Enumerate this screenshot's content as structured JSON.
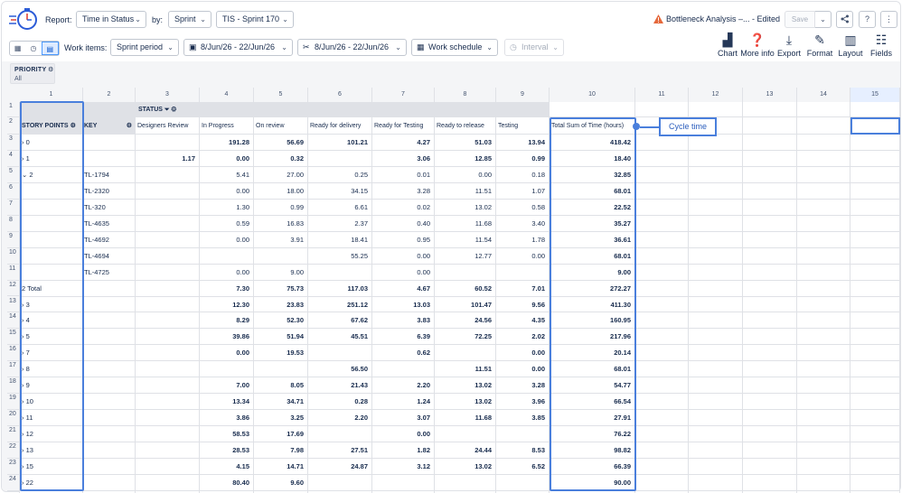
{
  "toolbar": {
    "report_label": "Report:",
    "report_value": "Time in Status",
    "by_label": "by:",
    "by_value": "Sprint",
    "sprint_value": "TIS - Sprint 170",
    "bottleneck_title": "Bottleneck Analysis –... - Edited",
    "save_label": "Save",
    "work_items_label": "Work items:",
    "work_items_value": "Sprint period",
    "date_range_1": "8/Jun/26 - 22/Jun/26",
    "date_range_2": "8/Jun/26 - 22/Jun/26",
    "work_schedule": "Work schedule",
    "interval": "Interval",
    "actions": {
      "chart": "Chart",
      "more_info": "More info",
      "export": "Export",
      "format": "Format",
      "layout": "Layout",
      "fields": "Fields"
    }
  },
  "priority": {
    "title": "PRIORITY",
    "value": "All"
  },
  "status_label": "STATUS",
  "col_numbers": [
    "1",
    "2",
    "3",
    "4",
    "5",
    "6",
    "7",
    "8",
    "9",
    "10",
    "11",
    "12",
    "13",
    "14",
    "15"
  ],
  "row_numbers": [
    "1",
    "2",
    "3",
    "4",
    "5",
    "6",
    "7",
    "8",
    "9",
    "10",
    "11",
    "12",
    "13",
    "14",
    "15",
    "16",
    "17",
    "18",
    "19",
    "20",
    "21",
    "22",
    "23",
    "24"
  ],
  "headers": {
    "story_points": "STORY POINTS",
    "key": "KEY",
    "statuses": [
      "Designers Review",
      "In Progress",
      "On review",
      "Ready for delivery",
      "Ready for Testing",
      "Ready to release",
      "Testing",
      "Total Sum of Time (hours)"
    ]
  },
  "rows": [
    {
      "sp": "0",
      "expand": ">",
      "key": "",
      "vals": [
        "",
        "191.28",
        "56.69",
        "101.21",
        "4.27",
        "51.03",
        "13.94",
        "418.42"
      ],
      "bold": true
    },
    {
      "sp": "1",
      "expand": ">",
      "key": "",
      "vals": [
        "1.17",
        "0.00",
        "0.32",
        "",
        "3.06",
        "12.85",
        "0.99",
        "18.40"
      ],
      "bold": true
    },
    {
      "sp": "2",
      "expand": "v",
      "key": "TL-1794",
      "vals": [
        "",
        "5.41",
        "27.00",
        "0.25",
        "0.01",
        "0.00",
        "0.18",
        "32.85"
      ],
      "bold": false
    },
    {
      "sp": "",
      "expand": "",
      "key": "TL-2320",
      "vals": [
        "",
        "0.00",
        "18.00",
        "34.15",
        "3.28",
        "11.51",
        "1.07",
        "68.01"
      ],
      "bold": false
    },
    {
      "sp": "",
      "expand": "",
      "key": "TL-320",
      "vals": [
        "",
        "1.30",
        "0.99",
        "6.61",
        "0.02",
        "13.02",
        "0.58",
        "22.52"
      ],
      "bold": false
    },
    {
      "sp": "",
      "expand": "",
      "key": "TL-4635",
      "vals": [
        "",
        "0.59",
        "16.83",
        "2.37",
        "0.40",
        "11.68",
        "3.40",
        "35.27"
      ],
      "bold": false
    },
    {
      "sp": "",
      "expand": "",
      "key": "TL-4692",
      "vals": [
        "",
        "0.00",
        "3.91",
        "18.41",
        "0.95",
        "11.54",
        "1.78",
        "36.61"
      ],
      "bold": false
    },
    {
      "sp": "",
      "expand": "",
      "key": "TL-4694",
      "vals": [
        "",
        "",
        "",
        "55.25",
        "0.00",
        "12.77",
        "0.00",
        "68.01"
      ],
      "bold": false
    },
    {
      "sp": "",
      "expand": "",
      "key": "TL-4725",
      "vals": [
        "",
        "0.00",
        "9.00",
        "",
        "0.00",
        "",
        "",
        "9.00"
      ],
      "bold": false
    },
    {
      "sp": "2 Total",
      "expand": "",
      "key": "",
      "vals": [
        "",
        "7.30",
        "75.73",
        "117.03",
        "4.67",
        "60.52",
        "7.01",
        "272.27"
      ],
      "bold": true,
      "total": true
    },
    {
      "sp": "3",
      "expand": ">",
      "key": "",
      "vals": [
        "",
        "12.30",
        "23.83",
        "251.12",
        "13.03",
        "101.47",
        "9.56",
        "411.30"
      ],
      "bold": true
    },
    {
      "sp": "4",
      "expand": ">",
      "key": "",
      "vals": [
        "",
        "8.29",
        "52.30",
        "67.62",
        "3.83",
        "24.56",
        "4.35",
        "160.95"
      ],
      "bold": true
    },
    {
      "sp": "5",
      "expand": ">",
      "key": "",
      "vals": [
        "",
        "39.86",
        "51.94",
        "45.51",
        "6.39",
        "72.25",
        "2.02",
        "217.96"
      ],
      "bold": true
    },
    {
      "sp": "7",
      "expand": ">",
      "key": "",
      "vals": [
        "",
        "0.00",
        "19.53",
        "",
        "0.62",
        "",
        "0.00",
        "20.14"
      ],
      "bold": true
    },
    {
      "sp": "8",
      "expand": ">",
      "key": "",
      "vals": [
        "",
        "",
        "",
        "56.50",
        "",
        "11.51",
        "0.00",
        "68.01"
      ],
      "bold": true
    },
    {
      "sp": "9",
      "expand": ">",
      "key": "",
      "vals": [
        "",
        "7.00",
        "8.05",
        "21.43",
        "2.20",
        "13.02",
        "3.28",
        "54.77"
      ],
      "bold": true
    },
    {
      "sp": "10",
      "expand": ">",
      "key": "",
      "vals": [
        "",
        "13.34",
        "34.71",
        "0.28",
        "1.24",
        "13.02",
        "3.96",
        "66.54"
      ],
      "bold": true
    },
    {
      "sp": "11",
      "expand": ">",
      "key": "",
      "vals": [
        "",
        "3.86",
        "3.25",
        "2.20",
        "3.07",
        "11.68",
        "3.85",
        "27.91"
      ],
      "bold": true
    },
    {
      "sp": "12",
      "expand": ">",
      "key": "",
      "vals": [
        "",
        "58.53",
        "17.69",
        "",
        "0.00",
        "",
        "",
        "76.22"
      ],
      "bold": true
    },
    {
      "sp": "13",
      "expand": ">",
      "key": "",
      "vals": [
        "",
        "28.53",
        "7.98",
        "27.51",
        "1.82",
        "24.44",
        "8.53",
        "98.82"
      ],
      "bold": true
    },
    {
      "sp": "15",
      "expand": ">",
      "key": "",
      "vals": [
        "",
        "4.15",
        "14.71",
        "24.87",
        "3.12",
        "13.02",
        "6.52",
        "66.39"
      ],
      "bold": true
    },
    {
      "sp": "22",
      "expand": ">",
      "key": "",
      "vals": [
        "",
        "80.40",
        "9.60",
        "",
        "",
        "",
        "",
        "90.00"
      ],
      "bold": true
    }
  ],
  "annotation": {
    "label": "Cycle time"
  },
  "colors": {
    "highlight": "#4a7fdc",
    "warning": "#e5683b",
    "header_bg": "#dfe1e6"
  }
}
